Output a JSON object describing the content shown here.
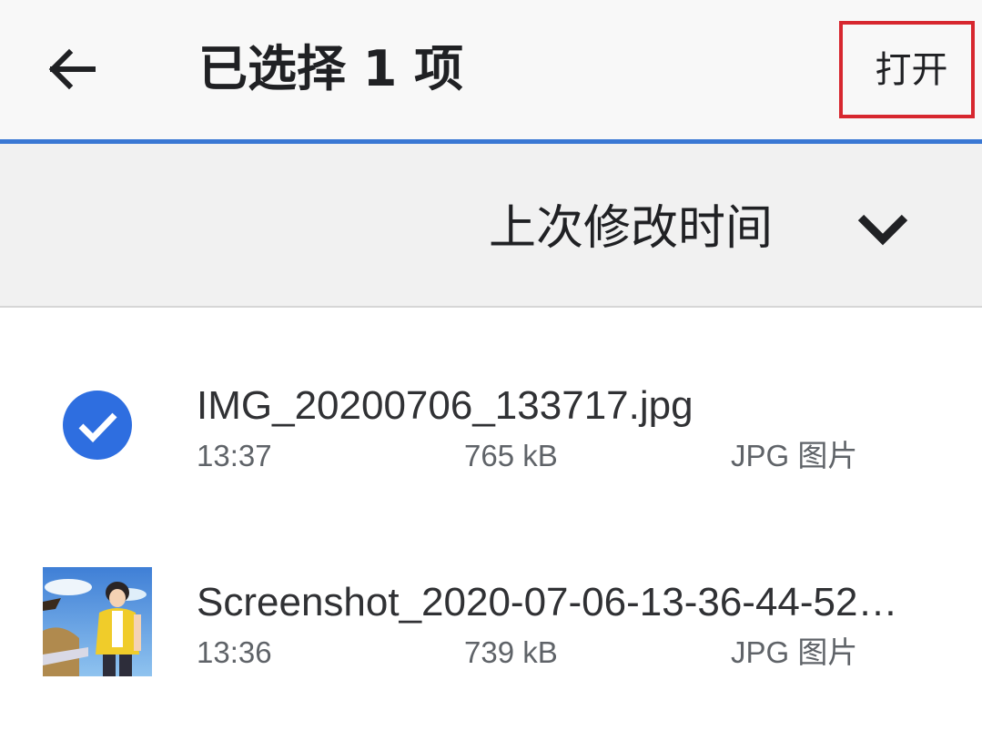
{
  "appbar": {
    "back_icon": "arrow-left-icon",
    "title": "已选择 1 项",
    "open_label": "打开",
    "highlight_color": "#d7272f",
    "accent_color": "#3a78d4"
  },
  "sort": {
    "label": "上次修改时间",
    "toggle_icon": "chevron-down-icon"
  },
  "files": [
    {
      "name": "IMG_20200706_133717.jpg",
      "time": "13:37",
      "size": "765 kB",
      "type": "JPG 图片",
      "selected": true,
      "leading_icon": "checkmark-circle-icon"
    },
    {
      "name": "Screenshot_2020-07-06-13-36-44-52…",
      "time": "13:36",
      "size": "739 kB",
      "type": "JPG 图片",
      "selected": false,
      "leading_icon": "image-thumbnail"
    }
  ]
}
